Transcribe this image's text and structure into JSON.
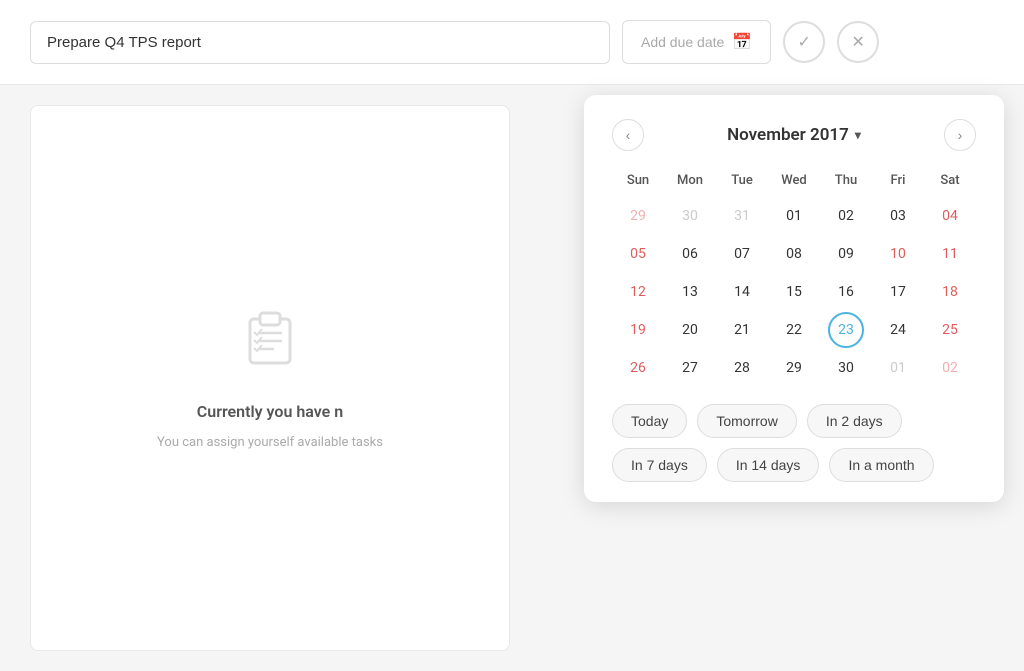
{
  "topbar": {
    "task_input_value": "Prepare Q4 TPS report",
    "task_input_placeholder": "Prepare Q4 TPS report",
    "due_date_label": "Add due date",
    "confirm_label": "✓",
    "cancel_label": "✕"
  },
  "content": {
    "empty_title": "Currently you have n",
    "empty_subtitle": "You can assign yourself\navailable tasks"
  },
  "calendar": {
    "month_title": "November 2017",
    "chevron": "▾",
    "prev_label": "‹",
    "next_label": "›",
    "weekdays": [
      "Sun",
      "Mon",
      "Tue",
      "Wed",
      "Thu",
      "Fri",
      "Sat"
    ],
    "weeks": [
      [
        {
          "day": "29",
          "type": "other-month weekend"
        },
        {
          "day": "30",
          "type": "other-month"
        },
        {
          "day": "31",
          "type": "other-month"
        },
        {
          "day": "01",
          "type": ""
        },
        {
          "day": "02",
          "type": ""
        },
        {
          "day": "03",
          "type": ""
        },
        {
          "day": "04",
          "type": "weekend"
        }
      ],
      [
        {
          "day": "05",
          "type": "weekend"
        },
        {
          "day": "06",
          "type": ""
        },
        {
          "day": "07",
          "type": ""
        },
        {
          "day": "08",
          "type": ""
        },
        {
          "day": "09",
          "type": ""
        },
        {
          "day": "10",
          "type": "weekend"
        },
        {
          "day": "11",
          "type": "weekend"
        }
      ],
      [
        {
          "day": "12",
          "type": "weekend"
        },
        {
          "day": "13",
          "type": ""
        },
        {
          "day": "14",
          "type": ""
        },
        {
          "day": "15",
          "type": ""
        },
        {
          "day": "16",
          "type": ""
        },
        {
          "day": "17",
          "type": ""
        },
        {
          "day": "18",
          "type": "weekend"
        }
      ],
      [
        {
          "day": "19",
          "type": "weekend"
        },
        {
          "day": "20",
          "type": ""
        },
        {
          "day": "21",
          "type": ""
        },
        {
          "day": "22",
          "type": ""
        },
        {
          "day": "23",
          "type": "today-circle"
        },
        {
          "day": "24",
          "type": ""
        },
        {
          "day": "25",
          "type": "weekend"
        }
      ],
      [
        {
          "day": "26",
          "type": "weekend"
        },
        {
          "day": "27",
          "type": ""
        },
        {
          "day": "28",
          "type": ""
        },
        {
          "day": "29",
          "type": ""
        },
        {
          "day": "30",
          "type": ""
        },
        {
          "day": "01",
          "type": "other-month"
        },
        {
          "day": "02",
          "type": "other-month weekend"
        }
      ]
    ],
    "quick_buttons": [
      "Today",
      "Tomorrow",
      "In 2 days",
      "In 7 days",
      "In 14 days",
      "In a month"
    ]
  }
}
